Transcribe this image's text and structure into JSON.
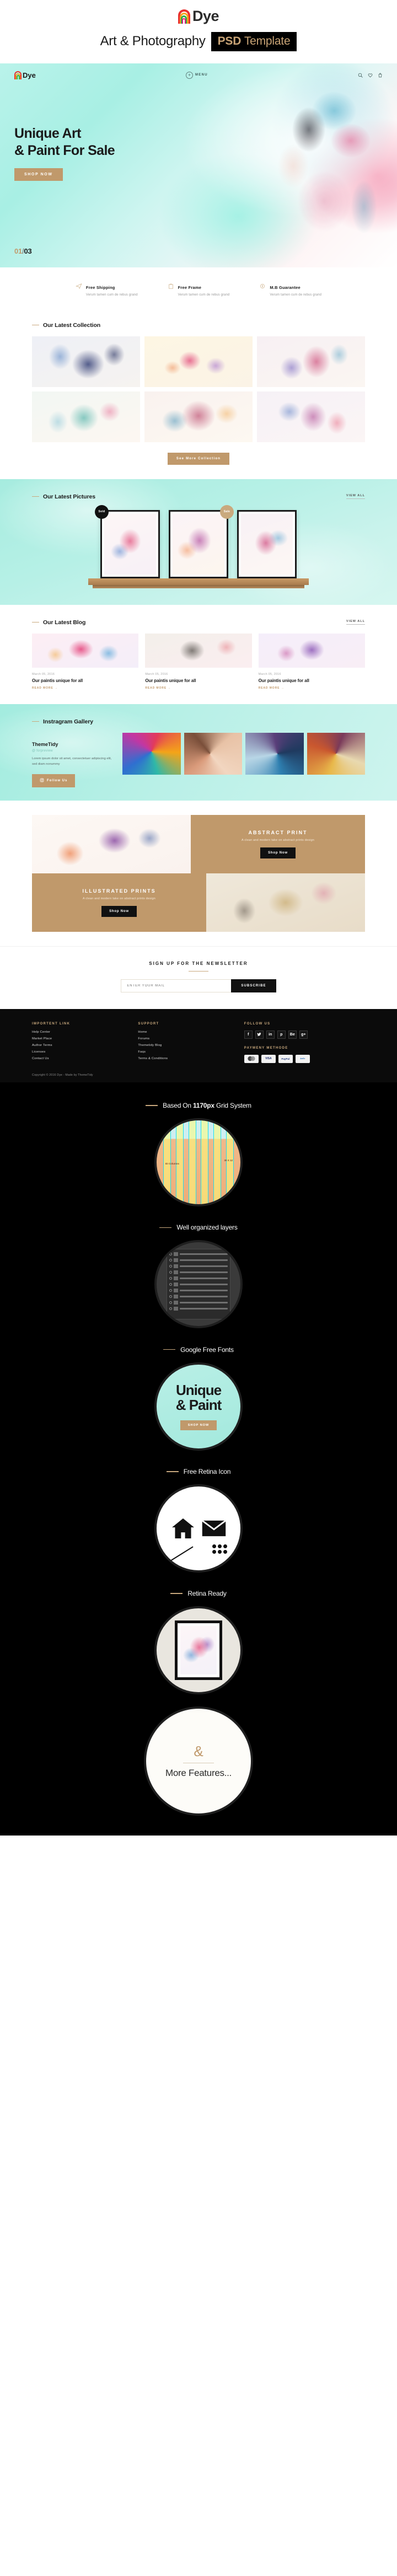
{
  "brand": {
    "logo_text": "Dye",
    "tagline_main": "Art & Photography",
    "tagline_badge_strong": "PSD",
    "tagline_badge_light": "Template"
  },
  "hero": {
    "logo_text": "Dye",
    "menu_label": "MENU",
    "heading_line1": "Unique Art",
    "heading_line2": "& Paint For Sale",
    "cta_label": "SHOP NOW",
    "slide_current": "01",
    "slide_separator": "/",
    "slide_total": "03",
    "icons": [
      "search-icon",
      "heart-icon",
      "cart-icon"
    ]
  },
  "features": [
    {
      "icon": "paper-plane-icon",
      "title": "Free Shipping",
      "desc": "Verum tamen cum de rebus grand"
    },
    {
      "icon": "frame-icon",
      "title": "Free Frame",
      "desc": "Verum tamen cum de rebus grand"
    },
    {
      "icon": "money-guarantee-icon",
      "title": "M.B Guarantee",
      "desc": "Verum tamen cum de rebus grand"
    }
  ],
  "collection": {
    "title": "Our Latest Collection",
    "cta_label": "See More Collection",
    "items": [
      {
        "name": "blue-portrait"
      },
      {
        "name": "pink-butterfly"
      },
      {
        "name": "magenta-portrait"
      },
      {
        "name": "teal-portrait"
      },
      {
        "name": "red-portrait"
      },
      {
        "name": "purple-portrait"
      }
    ]
  },
  "pictures": {
    "title": "Our Latest Pictures",
    "view_all": "VIEW ALL",
    "items": [
      {
        "name": "framed-art-1",
        "badge": "Sold",
        "badge_type": "sold"
      },
      {
        "name": "framed-art-2",
        "badge": "Sale",
        "badge_type": "sale"
      },
      {
        "name": "framed-art-3",
        "badge": "",
        "badge_type": ""
      }
    ]
  },
  "blog": {
    "title": "Our Latest Blog",
    "view_all": "VIEW ALL",
    "posts": [
      {
        "date": "March 05, 2016",
        "title": "Our paintis unique for all",
        "more": "READ MORE"
      },
      {
        "date": "March 05, 2016",
        "title": "Our paintis unique for all",
        "more": "READ MORE"
      },
      {
        "date": "March 05, 2016",
        "title": "Our paintis unique for all",
        "more": "READ MORE"
      }
    ]
  },
  "instagram": {
    "title": "Instragram Gallery",
    "account_name": "ThemeTidy",
    "handle": "@ forpreview",
    "description": "Lorem ipsum dolor sit amet, consectetuer adipiscing elit, sed diam nonummy",
    "follow_label": "Follow Us",
    "photos": [
      "insta-photo-1",
      "insta-photo-2",
      "insta-photo-3",
      "insta-photo-4"
    ]
  },
  "promos": [
    {
      "heading": "ABSTRACT PRINT",
      "subtext": "A clean and modern take on abstract prints design",
      "cta": "Shop Now",
      "image_side": "left"
    },
    {
      "heading": "ILLUSTRATED PRINTS",
      "subtext": "A clean and modern take on abstract prints design",
      "cta": "Shop Now",
      "image_side": "right"
    }
  ],
  "newsletter": {
    "heading": "SIGN UP FOR THE NEWSLETTER",
    "placeholder": "ENTER YOUR MAIL",
    "button": "SUBSCRIBE"
  },
  "footer": {
    "col1_heading": "IMPORTENT LINK",
    "col1_links": [
      "Help Center",
      "Market Place",
      "Author Terms",
      "Licenses",
      "Contact Us"
    ],
    "col2_heading": "SUPPORT",
    "col2_links": [
      "Home",
      "Forums",
      "Themetidy Blog",
      "Faqs",
      "Terms & Conditions"
    ],
    "col3_heading": "FOLLOW US",
    "socials": [
      "f",
      "t",
      "in",
      "p",
      "Be",
      "g+"
    ],
    "payment_heading": "PAYMENY METHODE",
    "payments": [
      "MasterCard",
      "VISA",
      "PayPal",
      "AmEx"
    ],
    "copyright": "Copyright © 2016 Dye - Made by ThemeTidy"
  },
  "showcase": {
    "blocks": [
      {
        "title_plain_before": "Based On ",
        "title_bold": "1170px",
        "title_plain_after": " Grid System",
        "visual": "grid-system-circle",
        "grid_label_left": "ID Columns",
        "grid_label_right": "30 X 12"
      },
      {
        "title_plain_before": "Well organized layers",
        "title_bold": "",
        "title_plain_after": "",
        "visual": "layers-panel-circle"
      },
      {
        "title_plain_before": "Google Free Fonts",
        "title_bold": "",
        "title_plain_after": "",
        "visual": "fonts-circle",
        "font_line1": "Unique",
        "font_line2": "& Paint",
        "font_btn": "SHOP NOW"
      },
      {
        "title_plain_before": "Free Retina Icon",
        "title_bold": "",
        "title_plain_after": "",
        "visual": "retina-icons-circle"
      },
      {
        "title_plain_before": "Retina Ready",
        "title_bold": "",
        "title_plain_after": "",
        "visual": "retina-ready-circle"
      }
    ],
    "more": {
      "amp": "&",
      "text": "More Features..."
    }
  }
}
